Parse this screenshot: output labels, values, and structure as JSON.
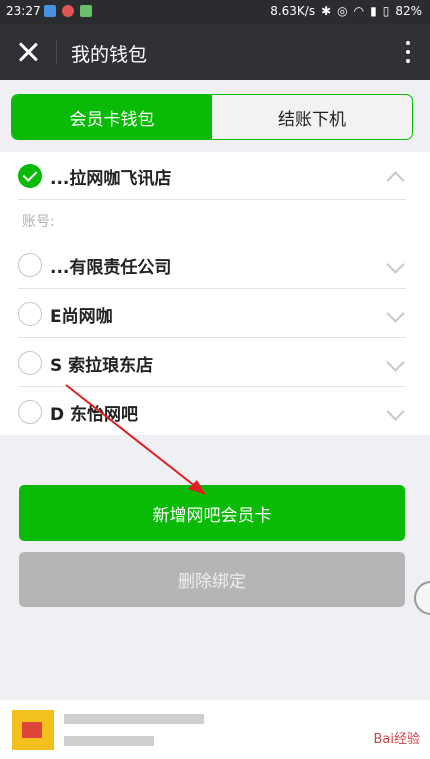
{
  "status_bar": {
    "time": "23:27",
    "speed": "8.63K/s",
    "battery": "82%",
    "icons": [
      "notification-icon",
      "app-icon",
      "leaf-icon",
      "bluetooth-icon",
      "alarm-icon",
      "wifi-icon",
      "signal-icon",
      "battery-icon"
    ]
  },
  "header": {
    "title": "我的钱包"
  },
  "tabs": [
    {
      "label": "会员卡钱包",
      "active": true
    },
    {
      "label": "结账下机",
      "active": false
    }
  ],
  "cards": [
    {
      "name": "...拉网咖飞讯店",
      "checked": true,
      "expanded": true
    },
    {
      "name": "...有限责任公司",
      "checked": false,
      "expanded": false
    },
    {
      "name": "E尚网咖",
      "checked": false,
      "expanded": false
    },
    {
      "name": "S 索拉琅东店",
      "checked": false,
      "expanded": false
    },
    {
      "name": "D 东怡网吧",
      "checked": false,
      "expanded": false
    }
  ],
  "account_label": "账号:",
  "buttons": {
    "add": "新增网吧会员卡",
    "delete": "删除绑定"
  },
  "colors": {
    "accent": "#09bb07",
    "header_bg": "#2f3135",
    "disabled": "#b5b5b5"
  },
  "watermark": "Bai经验"
}
